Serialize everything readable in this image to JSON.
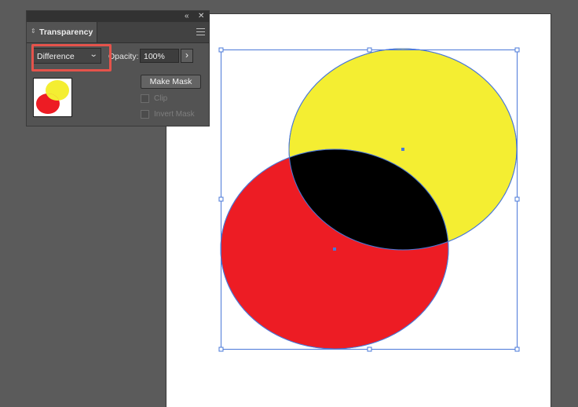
{
  "panel": {
    "tab_title": "Transparency",
    "blend_mode": "Difference",
    "opacity_label": "Opacity:",
    "opacity_value": "100%",
    "make_mask_label": "Make Mask",
    "clip_label": "Clip",
    "invert_mask_label": "Invert Mask",
    "collapse_glyph": "«",
    "close_glyph": "✕",
    "arrow_glyph": "›",
    "chevron_glyph": "⌄",
    "grip_glyph": "⇕"
  },
  "artwork": {
    "colors": {
      "yellow": "#f4ee32",
      "red": "#ed1c24",
      "overlap": "#000000",
      "selection": "#4a78d8",
      "panel_highlight": "#e5534b"
    },
    "shapes": [
      "yellow-ellipse",
      "red-ellipse"
    ]
  }
}
